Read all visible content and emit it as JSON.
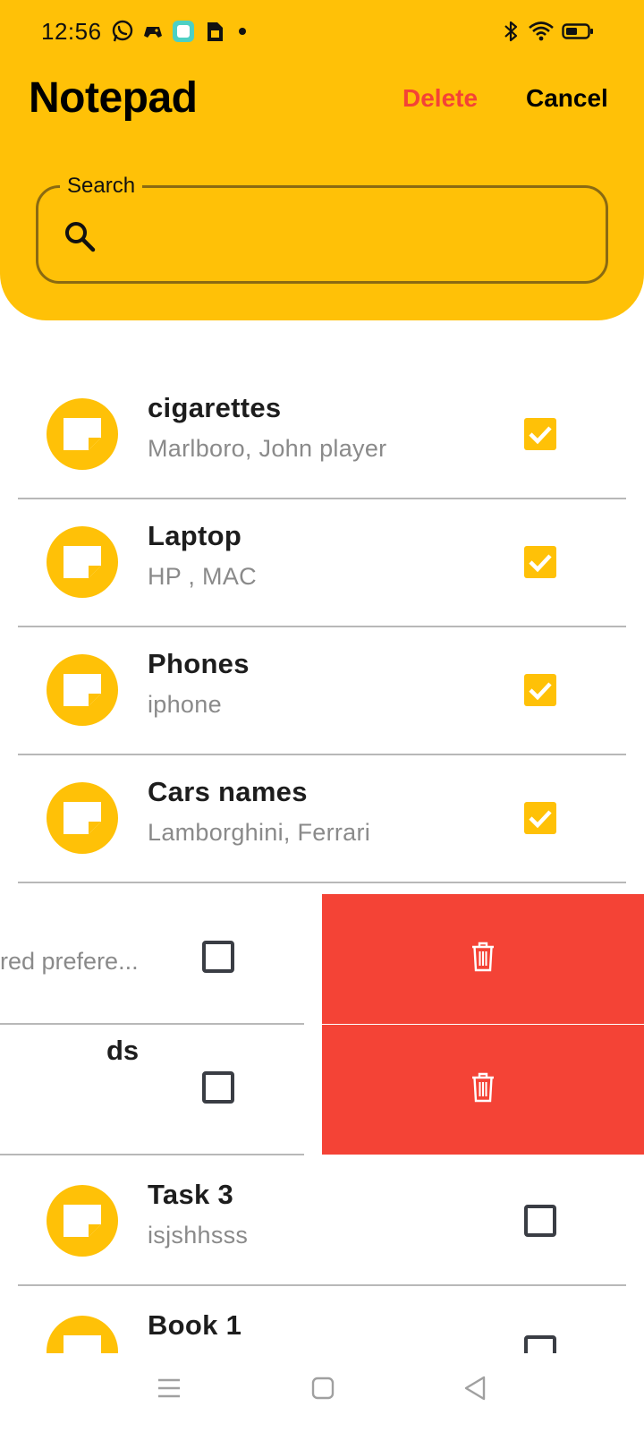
{
  "status_bar": {
    "time": "12:56",
    "left_icons": [
      "whatsapp-icon",
      "game-controller-icon",
      "app-badge-icon",
      "sim-card-icon",
      "dot-icon"
    ],
    "right_icons": [
      "bluetooth-icon",
      "wifi-icon",
      "battery-icon"
    ]
  },
  "header": {
    "title": "Notepad",
    "delete_label": "Delete",
    "cancel_label": "Cancel",
    "accent_color": "#FFC107",
    "danger_color": "#F44336"
  },
  "search": {
    "label": "Search",
    "value": "",
    "placeholder": ""
  },
  "notes": [
    {
      "title": "cigarettes",
      "subtitle": "Marlboro, John player",
      "selected": true
    },
    {
      "title": "Laptop",
      "subtitle": "HP , MAC",
      "selected": true
    },
    {
      "title": "Phones",
      "subtitle": "iphone",
      "selected": true
    },
    {
      "title": "Cars names",
      "subtitle": "Lamborghini, Ferrari",
      "selected": true
    }
  ],
  "swiped_notes": [
    {
      "visible_title": "",
      "visible_subtitle": "red prefere...",
      "selected": false,
      "action": "delete"
    },
    {
      "visible_title": "ds",
      "visible_subtitle": "",
      "selected": false,
      "action": "delete"
    }
  ],
  "notes_after": [
    {
      "title": "Task 3",
      "subtitle": "isjshhsss",
      "selected": false
    },
    {
      "title": "Book 1",
      "subtitle": "",
      "selected": false
    }
  ],
  "navbar": {
    "icons": [
      "menu-icon",
      "home-square-icon",
      "back-triangle-icon"
    ]
  }
}
